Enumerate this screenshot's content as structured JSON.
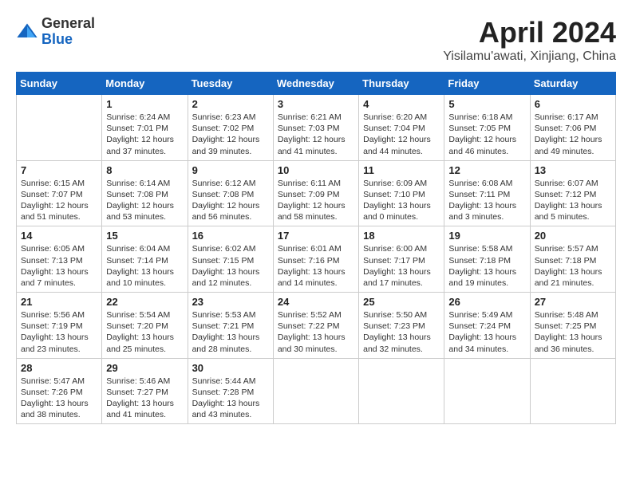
{
  "header": {
    "logo_general": "General",
    "logo_blue": "Blue",
    "month_title": "April 2024",
    "subtitle": "Yisilamu'awati, Xinjiang, China"
  },
  "weekdays": [
    "Sunday",
    "Monday",
    "Tuesday",
    "Wednesday",
    "Thursday",
    "Friday",
    "Saturday"
  ],
  "weeks": [
    [
      {
        "day": null,
        "sunrise": null,
        "sunset": null,
        "daylight": null
      },
      {
        "day": "1",
        "sunrise": "6:24 AM",
        "sunset": "7:01 PM",
        "daylight": "12 hours and 37 minutes."
      },
      {
        "day": "2",
        "sunrise": "6:23 AM",
        "sunset": "7:02 PM",
        "daylight": "12 hours and 39 minutes."
      },
      {
        "day": "3",
        "sunrise": "6:21 AM",
        "sunset": "7:03 PM",
        "daylight": "12 hours and 41 minutes."
      },
      {
        "day": "4",
        "sunrise": "6:20 AM",
        "sunset": "7:04 PM",
        "daylight": "12 hours and 44 minutes."
      },
      {
        "day": "5",
        "sunrise": "6:18 AM",
        "sunset": "7:05 PM",
        "daylight": "12 hours and 46 minutes."
      },
      {
        "day": "6",
        "sunrise": "6:17 AM",
        "sunset": "7:06 PM",
        "daylight": "12 hours and 49 minutes."
      }
    ],
    [
      {
        "day": "7",
        "sunrise": "6:15 AM",
        "sunset": "7:07 PM",
        "daylight": "12 hours and 51 minutes."
      },
      {
        "day": "8",
        "sunrise": "6:14 AM",
        "sunset": "7:08 PM",
        "daylight": "12 hours and 53 minutes."
      },
      {
        "day": "9",
        "sunrise": "6:12 AM",
        "sunset": "7:08 PM",
        "daylight": "12 hours and 56 minutes."
      },
      {
        "day": "10",
        "sunrise": "6:11 AM",
        "sunset": "7:09 PM",
        "daylight": "12 hours and 58 minutes."
      },
      {
        "day": "11",
        "sunrise": "6:09 AM",
        "sunset": "7:10 PM",
        "daylight": "13 hours and 0 minutes."
      },
      {
        "day": "12",
        "sunrise": "6:08 AM",
        "sunset": "7:11 PM",
        "daylight": "13 hours and 3 minutes."
      },
      {
        "day": "13",
        "sunrise": "6:07 AM",
        "sunset": "7:12 PM",
        "daylight": "13 hours and 5 minutes."
      }
    ],
    [
      {
        "day": "14",
        "sunrise": "6:05 AM",
        "sunset": "7:13 PM",
        "daylight": "13 hours and 7 minutes."
      },
      {
        "day": "15",
        "sunrise": "6:04 AM",
        "sunset": "7:14 PM",
        "daylight": "13 hours and 10 minutes."
      },
      {
        "day": "16",
        "sunrise": "6:02 AM",
        "sunset": "7:15 PM",
        "daylight": "13 hours and 12 minutes."
      },
      {
        "day": "17",
        "sunrise": "6:01 AM",
        "sunset": "7:16 PM",
        "daylight": "13 hours and 14 minutes."
      },
      {
        "day": "18",
        "sunrise": "6:00 AM",
        "sunset": "7:17 PM",
        "daylight": "13 hours and 17 minutes."
      },
      {
        "day": "19",
        "sunrise": "5:58 AM",
        "sunset": "7:18 PM",
        "daylight": "13 hours and 19 minutes."
      },
      {
        "day": "20",
        "sunrise": "5:57 AM",
        "sunset": "7:18 PM",
        "daylight": "13 hours and 21 minutes."
      }
    ],
    [
      {
        "day": "21",
        "sunrise": "5:56 AM",
        "sunset": "7:19 PM",
        "daylight": "13 hours and 23 minutes."
      },
      {
        "day": "22",
        "sunrise": "5:54 AM",
        "sunset": "7:20 PM",
        "daylight": "13 hours and 25 minutes."
      },
      {
        "day": "23",
        "sunrise": "5:53 AM",
        "sunset": "7:21 PM",
        "daylight": "13 hours and 28 minutes."
      },
      {
        "day": "24",
        "sunrise": "5:52 AM",
        "sunset": "7:22 PM",
        "daylight": "13 hours and 30 minutes."
      },
      {
        "day": "25",
        "sunrise": "5:50 AM",
        "sunset": "7:23 PM",
        "daylight": "13 hours and 32 minutes."
      },
      {
        "day": "26",
        "sunrise": "5:49 AM",
        "sunset": "7:24 PM",
        "daylight": "13 hours and 34 minutes."
      },
      {
        "day": "27",
        "sunrise": "5:48 AM",
        "sunset": "7:25 PM",
        "daylight": "13 hours and 36 minutes."
      }
    ],
    [
      {
        "day": "28",
        "sunrise": "5:47 AM",
        "sunset": "7:26 PM",
        "daylight": "13 hours and 38 minutes."
      },
      {
        "day": "29",
        "sunrise": "5:46 AM",
        "sunset": "7:27 PM",
        "daylight": "13 hours and 41 minutes."
      },
      {
        "day": "30",
        "sunrise": "5:44 AM",
        "sunset": "7:28 PM",
        "daylight": "13 hours and 43 minutes."
      },
      {
        "day": null,
        "sunrise": null,
        "sunset": null,
        "daylight": null
      },
      {
        "day": null,
        "sunrise": null,
        "sunset": null,
        "daylight": null
      },
      {
        "day": null,
        "sunrise": null,
        "sunset": null,
        "daylight": null
      },
      {
        "day": null,
        "sunrise": null,
        "sunset": null,
        "daylight": null
      }
    ]
  ],
  "labels": {
    "sunrise_prefix": "Sunrise: ",
    "sunset_prefix": "Sunset: ",
    "daylight_prefix": "Daylight: "
  }
}
